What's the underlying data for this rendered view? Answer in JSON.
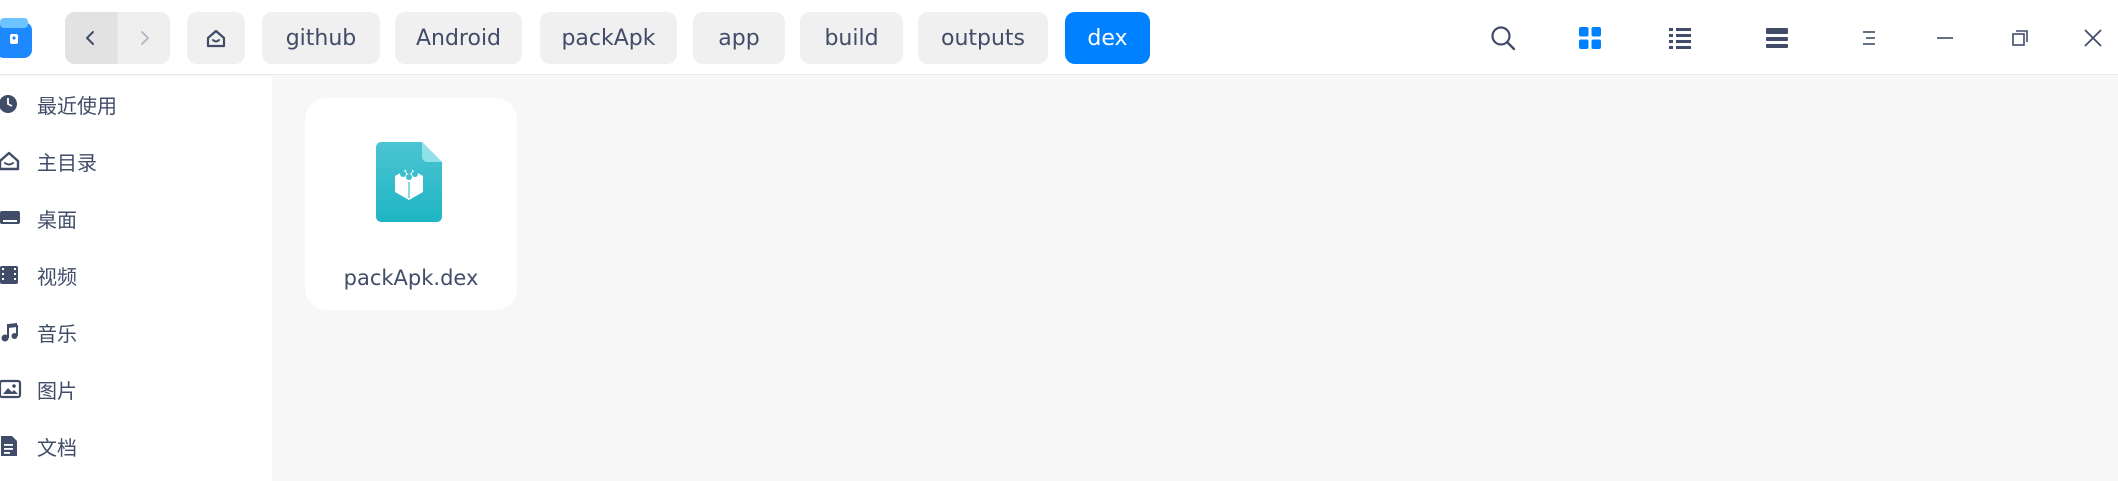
{
  "window": {
    "title": "dex",
    "accent": "#0081ff"
  },
  "navigation": {
    "back_icon": "chevron-left-icon",
    "forward_icon": "chevron-right-icon",
    "home_icon": "home-icon"
  },
  "breadcrumbs": [
    "github",
    "Android",
    "packApk",
    "app",
    "build",
    "outputs",
    "dex"
  ],
  "toolbar": {
    "icons": [
      "search-icon",
      "grid-view-icon",
      "list-view-icon",
      "detail-view-icon",
      "menu-icon",
      "minimize-icon",
      "maximize-icon",
      "close-icon"
    ]
  },
  "sidebar": {
    "items": [
      {
        "label": "最近使用",
        "icon": "clock-icon"
      },
      {
        "label": "主目录",
        "icon": "home-icon"
      },
      {
        "label": "桌面",
        "icon": "desktop-icon"
      },
      {
        "label": "视频",
        "icon": "video-icon"
      },
      {
        "label": "音乐",
        "icon": "music-icon"
      },
      {
        "label": "图片",
        "icon": "picture-icon"
      },
      {
        "label": "文档",
        "icon": "document-icon"
      }
    ]
  },
  "files": [
    {
      "name": "packApk.dex",
      "icon": "dex-file-icon"
    }
  ]
}
